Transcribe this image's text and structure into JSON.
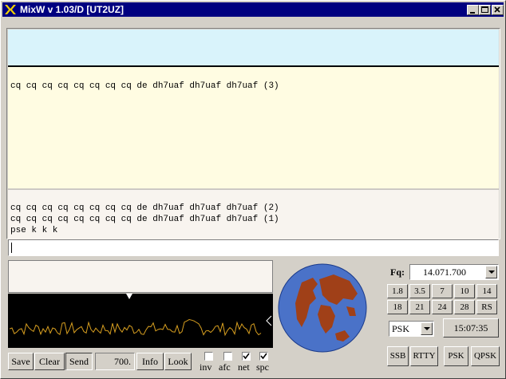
{
  "window": {
    "title": "MixW v 1.03/D [UT2UZ]"
  },
  "rx": {
    "main_line": "cq cq cq cq cq cq cq cq de dh7uaf dh7uaf dh7uaf (3)"
  },
  "tx": {
    "lines": [
      "cq cq cq cq cq cq cq cq de dh7uaf dh7uaf dh7uaf (2)",
      "cq cq cq cq cq cq cq cq de dh7uaf dh7uaf dh7uaf (1)",
      "pse k k k"
    ]
  },
  "input": {
    "value": ""
  },
  "buttons": {
    "save": "Save",
    "clear": "Clear",
    "send": "Send",
    "info": "Info",
    "look": "Look"
  },
  "audio_freq": "700.",
  "checkboxes": [
    {
      "label": "inv",
      "checked": false
    },
    {
      "label": "afc",
      "checked": false
    },
    {
      "label": "net",
      "checked": true
    },
    {
      "label": "spc",
      "checked": true
    }
  ],
  "frequency": {
    "label": "Fq:",
    "value": "14.071.700"
  },
  "bands": [
    "1.8",
    "3.5",
    "7",
    "10",
    "14",
    "18",
    "21",
    "24",
    "28",
    "RS"
  ],
  "mode_select": "PSK",
  "clock": "15:07:35",
  "mode_buttons": [
    "SSB",
    "RTTY",
    "PSK",
    "QPSK"
  ],
  "colors": {
    "title_bar": "#000080",
    "rx_top_bg": "#d9f3fb",
    "rx_main_bg": "#fffce2",
    "scope_trace": "#d9a020",
    "globe_ocean": "#4a72c8",
    "globe_land": "#a04018"
  }
}
